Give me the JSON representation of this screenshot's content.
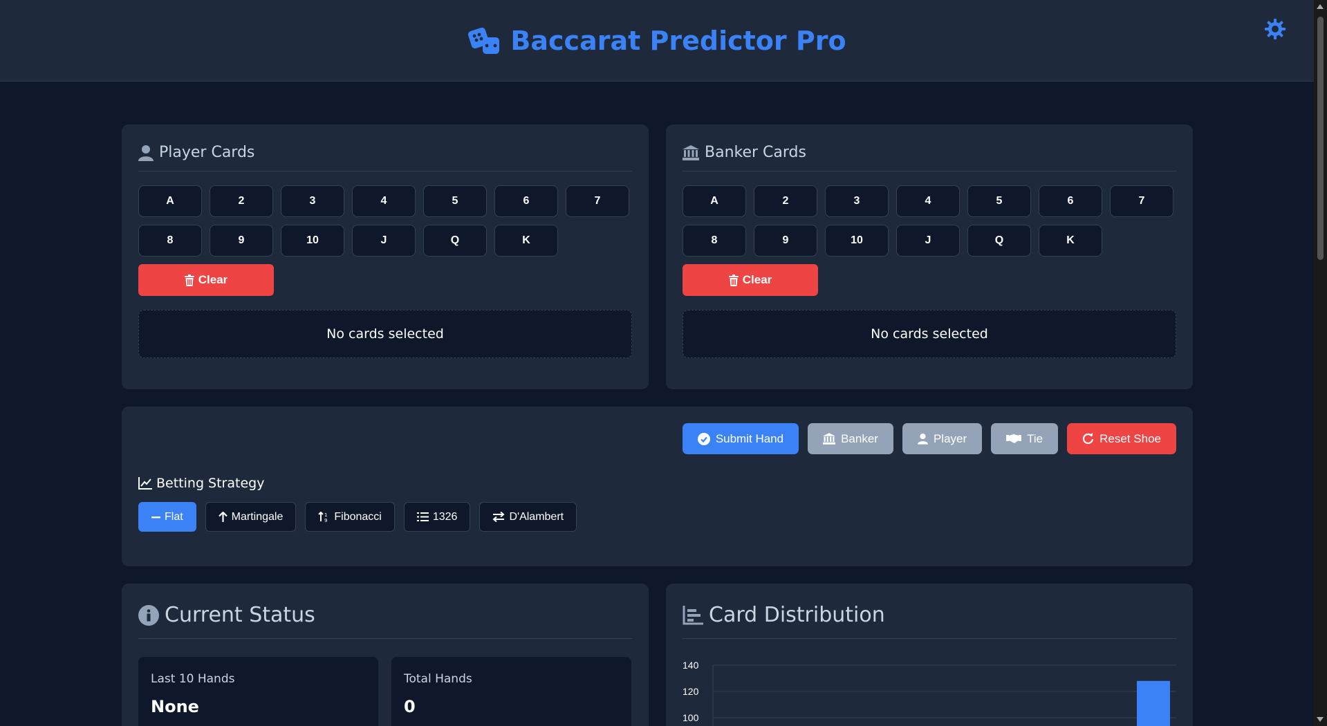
{
  "header": {
    "title": "Baccarat Predictor Pro"
  },
  "player": {
    "title": "Player Cards",
    "cards": [
      "A",
      "2",
      "3",
      "4",
      "5",
      "6",
      "7",
      "8",
      "9",
      "10",
      "J",
      "Q",
      "K"
    ],
    "clear_label": "Clear",
    "empty_text": "No cards selected"
  },
  "banker": {
    "title": "Banker Cards",
    "cards": [
      "A",
      "2",
      "3",
      "4",
      "5",
      "6",
      "7",
      "8",
      "9",
      "10",
      "J",
      "Q",
      "K"
    ],
    "clear_label": "Clear",
    "empty_text": "No cards selected"
  },
  "actions": {
    "submit": "Submit Hand",
    "banker": "Banker",
    "player": "Player",
    "tie": "Tie",
    "reset": "Reset Shoe"
  },
  "strategy": {
    "title": "Betting Strategy",
    "options": [
      "Flat",
      "Martingale",
      "Fibonacci",
      "1326",
      "D'Alambert"
    ],
    "active": "Flat"
  },
  "status": {
    "title": "Current Status",
    "last_label": "Last 10 Hands",
    "last_value": "None",
    "total_label": "Total Hands",
    "total_value": "0"
  },
  "distribution": {
    "title": "Card Distribution"
  },
  "colors": {
    "accent": "#3b82f6",
    "danger": "#ef4444",
    "grey": "#94a3b8"
  },
  "chart_data": {
    "type": "bar",
    "ylim": [
      100,
      140
    ],
    "yticks": [
      "140",
      "120",
      "100"
    ],
    "values": [
      128
    ],
    "grid": true
  }
}
